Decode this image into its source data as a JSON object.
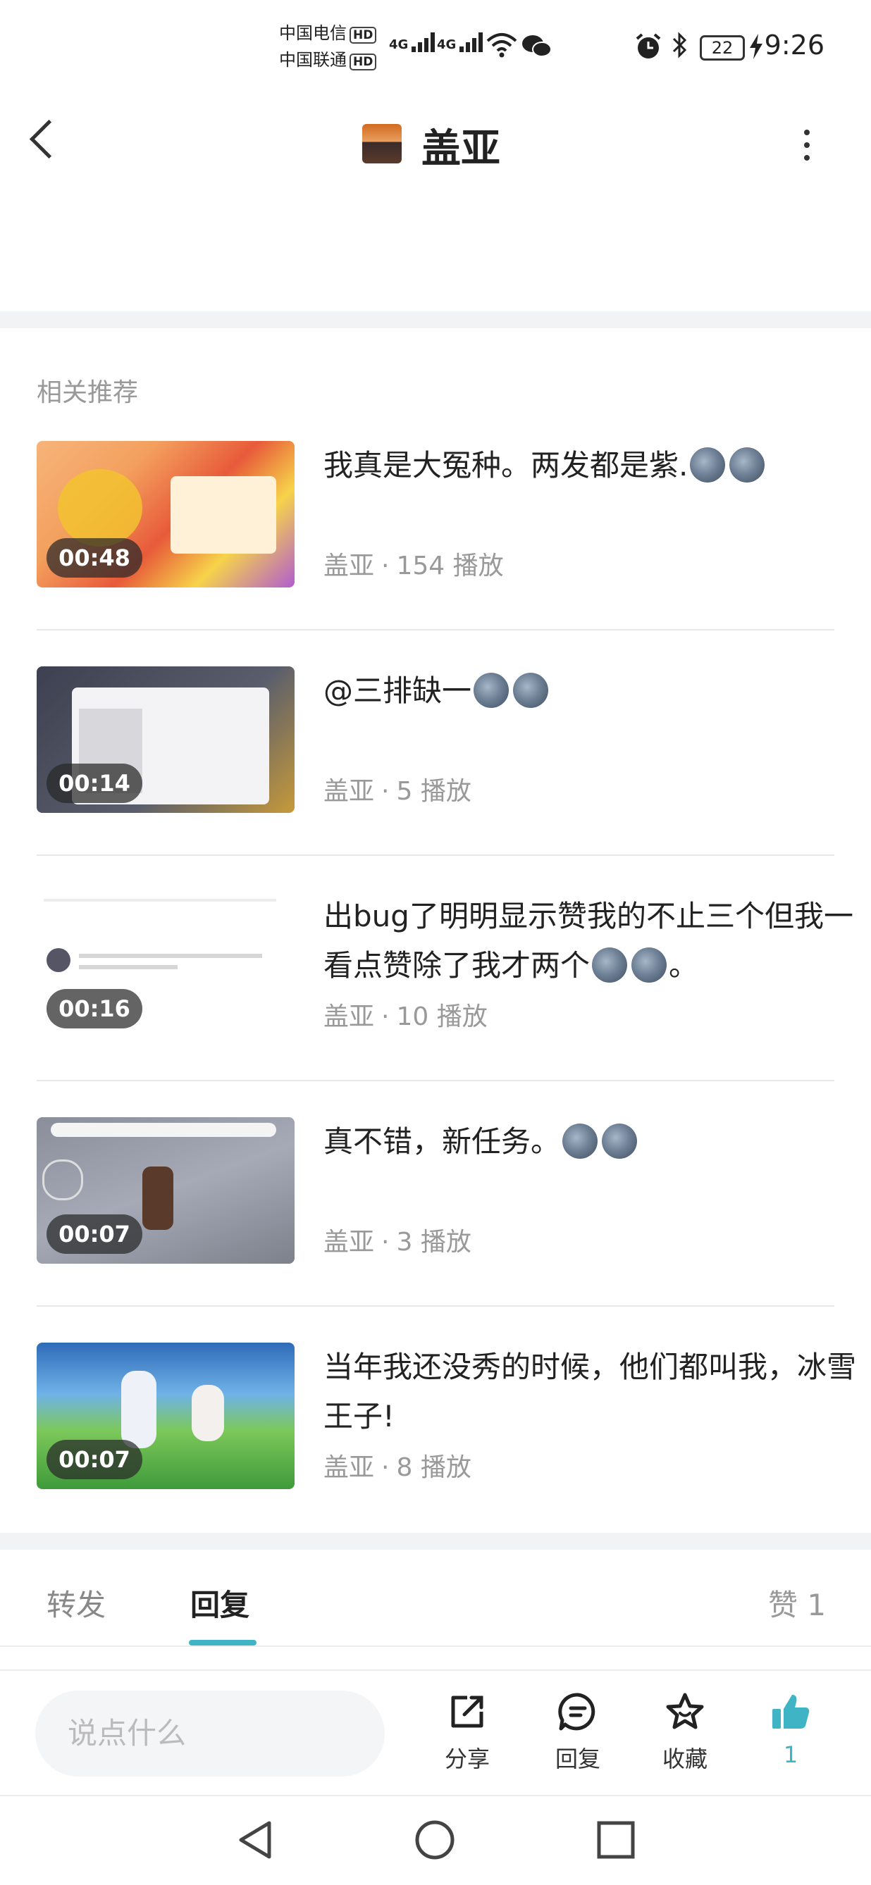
{
  "status_bar": {
    "carrier1": "中国电信",
    "carrier2": "中国联通",
    "hd": "HD",
    "net": "4G",
    "battery": "22",
    "time": "9:26"
  },
  "header": {
    "title": "盖亚",
    "icons": {
      "back": "back-chevron-icon",
      "more": "more-vertical-icon"
    }
  },
  "section_label": "相关推荐",
  "videos": [
    {
      "duration": "00:48",
      "title": "我真是大冤种。两发都是紫.",
      "emoji_count": 2,
      "author": "盖亚",
      "sep": "·",
      "plays": "154 播放",
      "title_suffix": ""
    },
    {
      "duration": "00:14",
      "title": "@三排缺一",
      "emoji_count": 2,
      "author": "盖亚",
      "sep": "·",
      "plays": "5 播放",
      "title_suffix": ""
    },
    {
      "duration": "00:16",
      "title": "出bug了明明显示赞我的不止三个但我一看点赞除了我才两个",
      "emoji_count": 2,
      "title_suffix": "。",
      "author": "盖亚",
      "sep": "·",
      "plays": "10 播放"
    },
    {
      "duration": "00:07",
      "title": "真不错，新任务。",
      "emoji_count": 2,
      "author": "盖亚",
      "sep": "·",
      "plays": "3 播放",
      "title_suffix": ""
    },
    {
      "duration": "00:07",
      "title": "当年我还没秀的时候，他们都叫我，冰雪王子!",
      "emoji_count": 0,
      "author": "盖亚",
      "sep": "·",
      "plays": "8 播放",
      "title_suffix": ""
    }
  ],
  "tabs": {
    "forward": "转发",
    "reply": "回复",
    "likes": "赞 1",
    "active": "reply",
    "accent": "#3eb4c4"
  },
  "bottom_bar": {
    "placeholder": "说点什么",
    "share": "分享",
    "reply": "回复",
    "favorite": "收藏",
    "like_count": "1",
    "like_color": "#3eb4c4"
  },
  "nav": {
    "icons": [
      "nav-back-icon",
      "nav-home-icon",
      "nav-recents-icon"
    ]
  }
}
